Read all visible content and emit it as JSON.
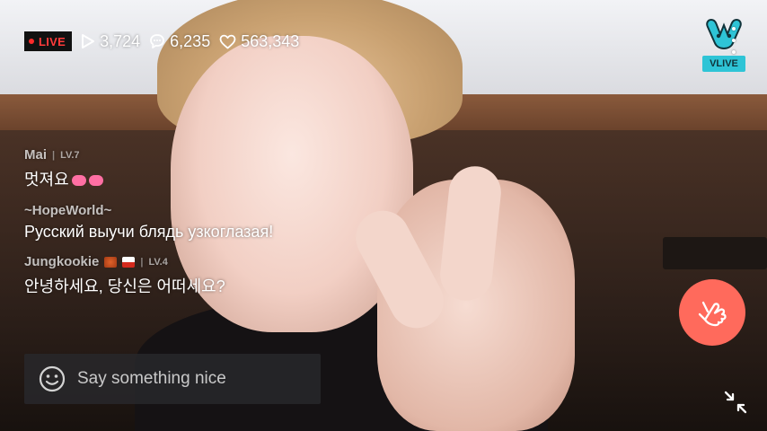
{
  "live_badge": "LIVE",
  "stats": {
    "views": "3,724",
    "comments": "6,235",
    "likes": "563,343"
  },
  "logo": {
    "text": "VLIVE"
  },
  "chat": [
    {
      "username": "Mai",
      "level": "LV.7",
      "text": "멋져요"
    },
    {
      "username": "~HopeWorld~",
      "level": "",
      "text": "Русский выучи блядь узкоглазая!"
    },
    {
      "username": "Jungkookie",
      "level": "LV.4",
      "text": "안녕하세요, 당신은 어떠세요?"
    }
  ],
  "input": {
    "placeholder": "Say something nice",
    "value": ""
  },
  "colors": {
    "accent_heart_button": "#ff6a5c",
    "live_red": "#ff3b3b",
    "vlive_cyan": "#2ec4d6"
  },
  "icons": [
    "play-icon",
    "comment-icon",
    "heart-icon",
    "more-icon",
    "smile-icon",
    "finger-heart-icon",
    "collapse-icon"
  ]
}
